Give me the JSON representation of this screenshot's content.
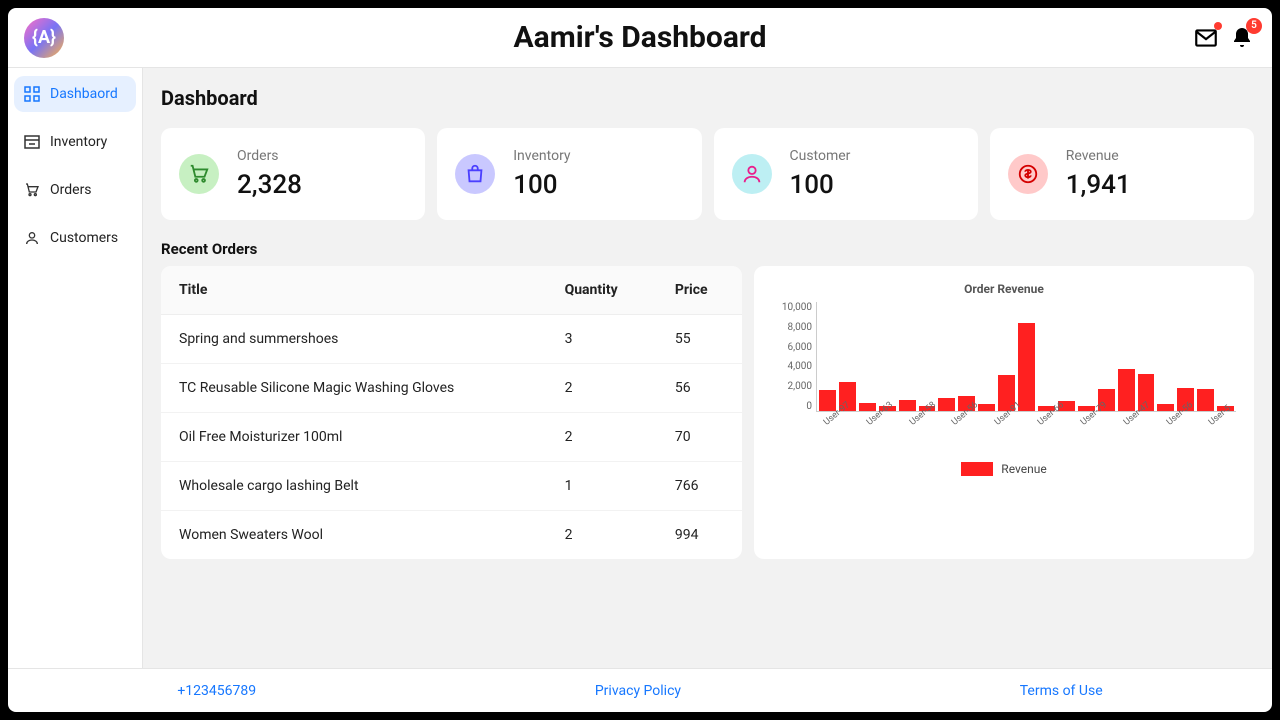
{
  "header": {
    "avatar_text": "{A}",
    "title": "Aamir's Dashboard",
    "notifications_count": "5"
  },
  "sidebar": {
    "items": [
      {
        "label": "Dashbaord",
        "active": true
      },
      {
        "label": "Inventory",
        "active": false
      },
      {
        "label": "Orders",
        "active": false
      },
      {
        "label": "Customers",
        "active": false
      }
    ]
  },
  "main": {
    "heading": "Dashboard",
    "cards": [
      {
        "label": "Orders",
        "value": "2,328"
      },
      {
        "label": "Inventory",
        "value": "100"
      },
      {
        "label": "Customer",
        "value": "100"
      },
      {
        "label": "Revenue",
        "value": "1,941"
      }
    ],
    "recent_orders_heading": "Recent Orders",
    "table": {
      "columns": [
        "Title",
        "Quantity",
        "Price"
      ],
      "rows": [
        {
          "title": "Spring and summershoes",
          "quantity": "3",
          "price": "55"
        },
        {
          "title": "TC Reusable Silicone Magic Washing Gloves",
          "quantity": "2",
          "price": "56"
        },
        {
          "title": "Oil Free Moisturizer 100ml",
          "quantity": "2",
          "price": "70"
        },
        {
          "title": "Wholesale cargo lashing Belt",
          "quantity": "1",
          "price": "766"
        },
        {
          "title": "Women Sweaters Wool",
          "quantity": "2",
          "price": "994"
        }
      ]
    },
    "chart": {
      "title": "Order Revenue",
      "legend": "Revenue",
      "y_ticks": [
        "10,000",
        "8,000",
        "6,000",
        "4,000",
        "2,000",
        "0"
      ]
    }
  },
  "footer": {
    "phone": "+123456789",
    "privacy": "Privacy Policy",
    "terms": "Terms of Use"
  },
  "chart_data": {
    "type": "bar",
    "title": "Order Revenue",
    "ylabel": "Revenue",
    "ylim": [
      0,
      10000
    ],
    "categories": [
      "User-97",
      "",
      "User-63",
      "",
      "User-58",
      "",
      "User-56",
      "",
      "User-91",
      "",
      "User-66",
      "",
      "User-79",
      "",
      "User-47",
      "",
      "User-56",
      "",
      "User-5",
      ""
    ],
    "series": [
      {
        "name": "Revenue",
        "values": [
          1900,
          2700,
          700,
          500,
          1000,
          500,
          1200,
          1400,
          600,
          3300,
          8100,
          500,
          900,
          500,
          2000,
          3900,
          3400,
          600,
          2100,
          2000,
          500
        ]
      }
    ]
  }
}
